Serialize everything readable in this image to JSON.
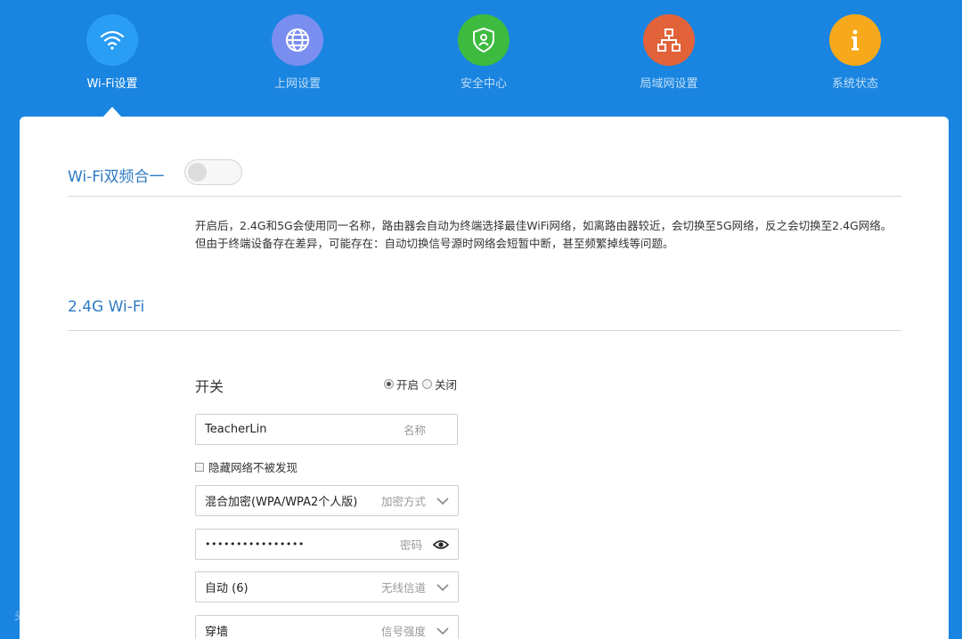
{
  "nav": {
    "items": [
      {
        "label": "Wi-Fi设置",
        "icon": "wifi-icon",
        "color": "#2a9df4",
        "active": true
      },
      {
        "label": "上网设置",
        "icon": "globe-icon",
        "color": "#7a8ef0",
        "active": false
      },
      {
        "label": "安全中心",
        "icon": "shield-icon",
        "color": "#3dbb3f",
        "active": false
      },
      {
        "label": "局域网设置",
        "icon": "lan-icon",
        "color": "#e2623a",
        "active": false
      },
      {
        "label": "系统状态",
        "icon": "info-icon",
        "color": "#f7a91c",
        "active": false
      }
    ]
  },
  "dual_band": {
    "title": "Wi-Fi双频合一",
    "enabled": false,
    "description_line1": "开启后，2.4G和5G会使用同一名称，路由器会自动为终端选择最佳WiFi网络，如离路由器较近，会切换至5G网络，反之会切换至2.4G网络。",
    "description_line2": "但由于终端设备存在差异，可能存在：自动切换信号源时网络会短暂中断，甚至频繁掉线等问题。"
  },
  "wifi24": {
    "title": "2.4G Wi-Fi",
    "switch_label": "开关",
    "radio_on": "开启",
    "radio_off": "关闭",
    "selected": "on",
    "name_value": "TeacherLin",
    "name_hint": "名称",
    "hide_network_label": "隐藏网络不被发现",
    "encryption_value": "混合加密(WPA/WPA2个人版)",
    "encryption_hint": "加密方式",
    "password_value": "••••••••••••••••",
    "password_hint": "密码",
    "channel_value": "自动 (6)",
    "channel_hint": "无线信道",
    "strength_value": "穿墙",
    "strength_hint": "信号强度"
  },
  "watermark": "头条@会情极致老师",
  "colors": {
    "background": "#1a85e0",
    "accent_text": "#2d7bc4"
  }
}
